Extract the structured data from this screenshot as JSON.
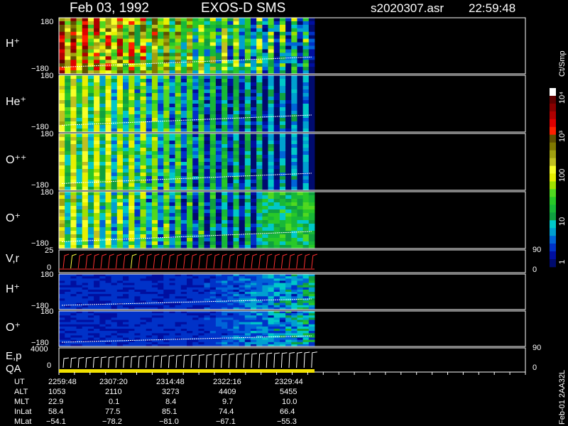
{
  "header": {
    "date": "Feb 03, 1992",
    "instrument": "EXOS-D SMS",
    "file": "s2020307.asr",
    "time": "22:59:48"
  },
  "colorbar": {
    "unit": "Ct/Smp",
    "ticks": [
      "1",
      "10",
      "100",
      "10³",
      "10⁴"
    ],
    "colors": [
      "#000b6e",
      "#000fa0",
      "#0032c8",
      "#0064d8",
      "#00a0d0",
      "#00c8c8",
      "#10a040",
      "#18b838",
      "#28c828",
      "#50d820",
      "#a0e000",
      "#e8f000",
      "#f8ff28",
      "#c0c020",
      "#a0a010",
      "#807800",
      "#605000",
      "#ff2000",
      "#e00000",
      "#b00000",
      "#880000",
      "#600000",
      "#ffffff"
    ]
  },
  "panels": [
    {
      "id": "h_plus",
      "label": "H⁺",
      "ymin": "−180",
      "ymax": "180",
      "style": "hot"
    },
    {
      "id": "he_plus",
      "label": "He⁺",
      "ymin": "−180",
      "ymax": "180",
      "style": "warm"
    },
    {
      "id": "o_plusplus",
      "label": "O⁺⁺",
      "ymin": "−180",
      "ymax": "180",
      "style": "warm"
    },
    {
      "id": "o_plus",
      "label": "O⁺",
      "ymin": "−180",
      "ymax": "180",
      "style": "warm2"
    },
    {
      "id": "h_plus_2",
      "label": "H⁺",
      "ymin": "−180",
      "ymax": "180",
      "style": "cold"
    },
    {
      "id": "o_plus_2",
      "label": "O⁺",
      "ymin": "−180",
      "ymax": "180",
      "style": "cold"
    }
  ],
  "vr_panel": {
    "label": "V,r",
    "ymin": "0",
    "ymax": "25",
    "right_top": "90",
    "right_bottom": "0"
  },
  "ep_panel": {
    "label": "E,p",
    "label2": "QA",
    "ymin": "0",
    "ymax": "4000",
    "right_top": "90",
    "right_bottom": "0"
  },
  "side_label": "Feb-01 2AA32L",
  "ephemeris": {
    "rows": [
      "UT",
      "ALT",
      "MLT",
      "InLat",
      "MLat"
    ],
    "columns": [
      [
        "2259:48",
        "1053",
        "22.9",
        "58.4",
        "−54.1"
      ],
      [
        "2307:20",
        "2110",
        "0.1",
        "77.5",
        "−78.2"
      ],
      [
        "2314:48",
        "3273",
        "8.4",
        "85.1",
        "−81.0"
      ],
      [
        "2322:16",
        "4409",
        "9.7",
        "74.4",
        "−67.1"
      ],
      [
        "2329:44",
        "5455",
        "10.0",
        "66.4",
        "−55.3"
      ]
    ]
  },
  "chart_data": {
    "type": "heatmap",
    "title": "Feb 03, 1992   EXOS-D SMS",
    "x": [
      "2259:48",
      "2307:20",
      "2314:48",
      "2322:16",
      "2329:44"
    ],
    "series": [
      {
        "name": "H⁺",
        "ylim": [
          -180,
          180
        ]
      },
      {
        "name": "He⁺",
        "ylim": [
          -180,
          180
        ]
      },
      {
        "name": "O⁺⁺",
        "ylim": [
          -180,
          180
        ]
      },
      {
        "name": "O⁺",
        "ylim": [
          -180,
          180
        ]
      },
      {
        "name": "H⁺",
        "ylim": [
          -180,
          180
        ]
      },
      {
        "name": "O⁺",
        "ylim": [
          -180,
          180
        ]
      }
    ],
    "colorbar_scale": "log",
    "colorbar_range": [
      1,
      10000
    ]
  }
}
